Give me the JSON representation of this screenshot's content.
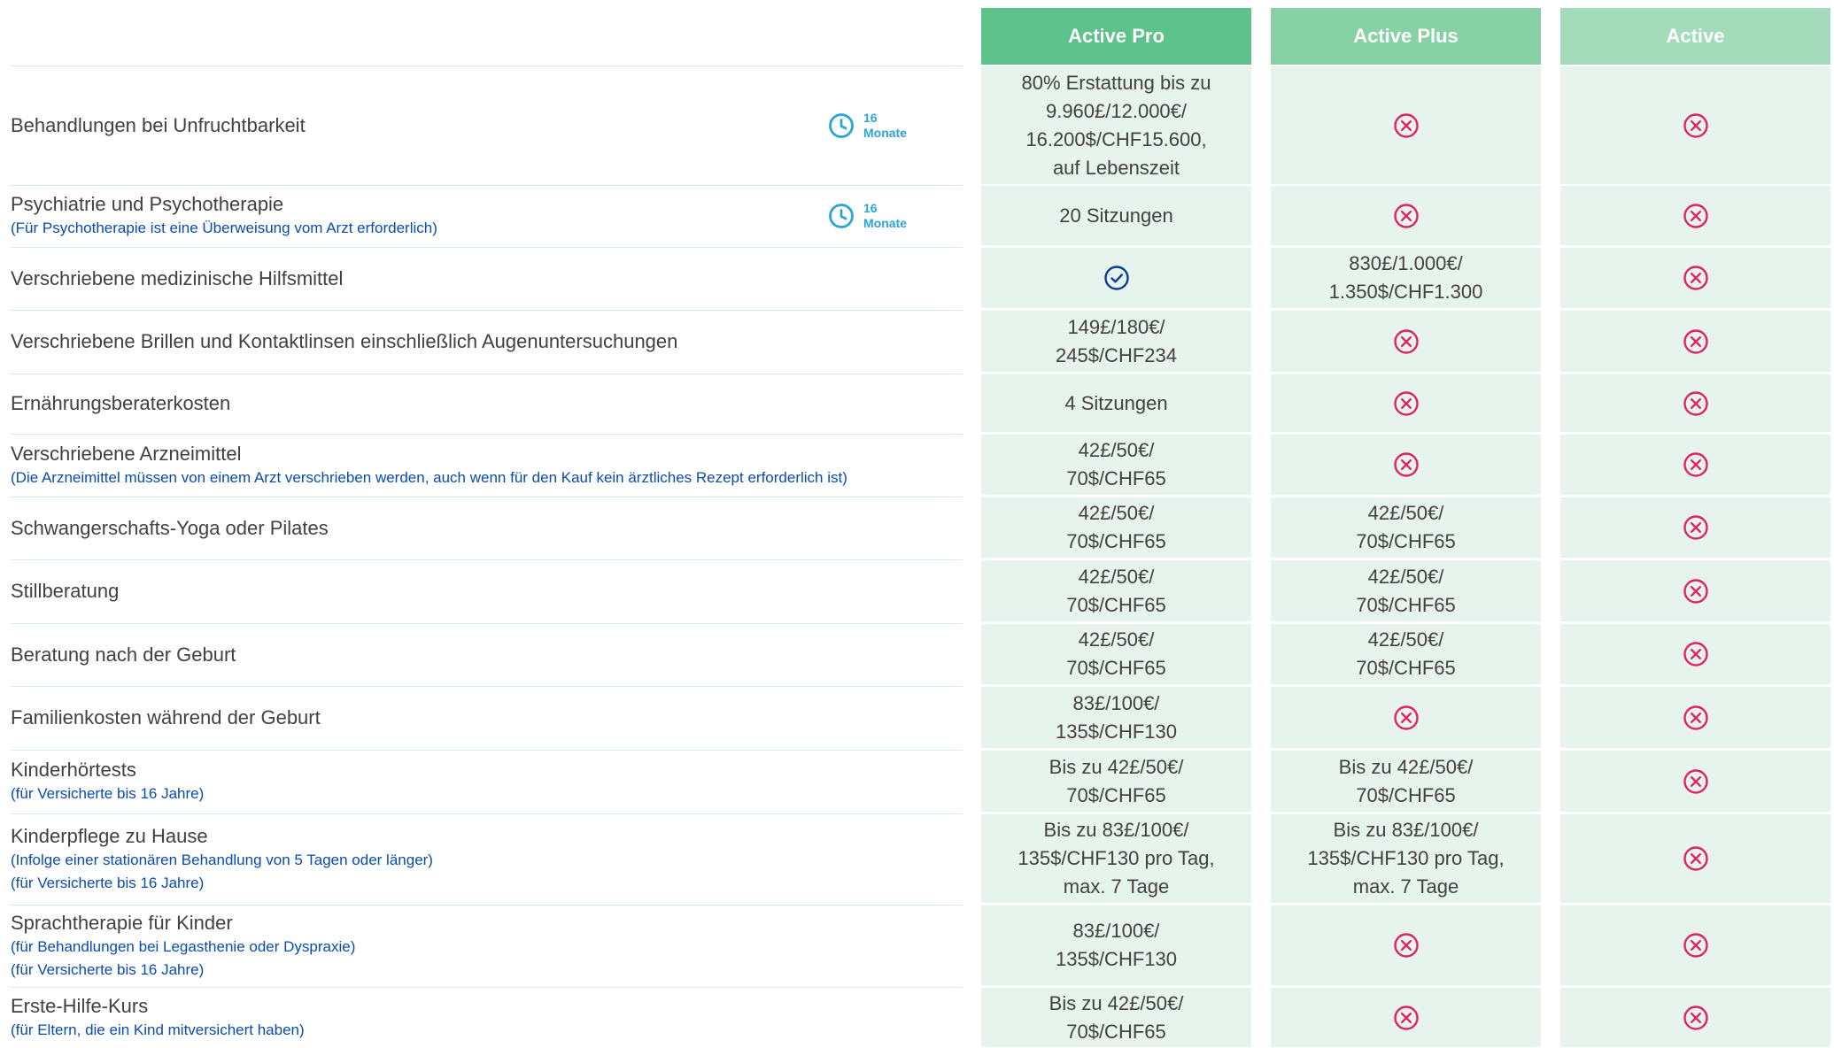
{
  "plans": [
    "Active Pro",
    "Active Plus",
    "Active"
  ],
  "colors": {
    "header_pro": "#5ec28d",
    "header_plus": "#88d1a6",
    "header_active": "#a4dcbb",
    "cell_bg": "#e6f4ed",
    "cross": "#e0235f",
    "check": "#0a3d91",
    "note": "#0a4bb0",
    "waiting": "#2aa5d6"
  },
  "icons": {
    "not_covered": "x-circle-icon",
    "covered": "check-circle-icon",
    "waiting_period": "clock-icon"
  },
  "rows": [
    {
      "label": "Behandlungen bei Unfruchtbarkeit",
      "notes": [],
      "waiting": {
        "number": "16",
        "unit": "Monate"
      },
      "values": [
        {
          "type": "text",
          "lines": [
            "80% Erstattung bis zu",
            "9.960£/12.000€/",
            "16.200$/CHF15.600,",
            "auf Lebenszeit"
          ]
        },
        {
          "type": "cross"
        },
        {
          "type": "cross"
        }
      ]
    },
    {
      "label": "Psychiatrie und Psychotherapie",
      "notes": [
        "(Für Psychotherapie ist eine Überweisung vom Arzt erforderlich)"
      ],
      "waiting": {
        "number": "16",
        "unit": "Monate"
      },
      "values": [
        {
          "type": "text",
          "lines": [
            "20 Sitzungen"
          ]
        },
        {
          "type": "cross"
        },
        {
          "type": "cross"
        }
      ]
    },
    {
      "label": "Verschriebene medizinische Hilfsmittel",
      "notes": [],
      "values": [
        {
          "type": "check"
        },
        {
          "type": "text",
          "lines": [
            "830£/1.000€/",
            "1.350$/CHF1.300"
          ]
        },
        {
          "type": "cross"
        }
      ]
    },
    {
      "label": "Verschriebene Brillen und Kontaktlinsen einschließlich Augenuntersuchungen",
      "notes": [],
      "values": [
        {
          "type": "text",
          "lines": [
            "149£/180€/",
            "245$/CHF234"
          ]
        },
        {
          "type": "cross"
        },
        {
          "type": "cross"
        }
      ]
    },
    {
      "label": "Ernährungsberaterkosten",
      "notes": [],
      "values": [
        {
          "type": "text",
          "lines": [
            "4 Sitzungen"
          ]
        },
        {
          "type": "cross"
        },
        {
          "type": "cross"
        }
      ]
    },
    {
      "label": "Verschriebene Arzneimittel",
      "notes": [
        "(Die Arzneimittel müssen von einem Arzt verschrieben werden, auch wenn für den Kauf kein ärztliches Rezept erforderlich ist)"
      ],
      "values": [
        {
          "type": "text",
          "lines": [
            "42£/50€/",
            "70$/CHF65"
          ]
        },
        {
          "type": "cross"
        },
        {
          "type": "cross"
        }
      ]
    },
    {
      "label": "Schwangerschafts-Yoga oder Pilates",
      "notes": [],
      "values": [
        {
          "type": "text",
          "lines": [
            "42£/50€/",
            "70$/CHF65"
          ]
        },
        {
          "type": "text",
          "lines": [
            "42£/50€/",
            "70$/CHF65"
          ]
        },
        {
          "type": "cross"
        }
      ]
    },
    {
      "label": "Stillberatung",
      "notes": [],
      "values": [
        {
          "type": "text",
          "lines": [
            "42£/50€/",
            "70$/CHF65"
          ]
        },
        {
          "type": "text",
          "lines": [
            "42£/50€/",
            "70$/CHF65"
          ]
        },
        {
          "type": "cross"
        }
      ]
    },
    {
      "label": "Beratung nach der Geburt",
      "notes": [],
      "values": [
        {
          "type": "text",
          "lines": [
            "42£/50€/",
            "70$/CHF65"
          ]
        },
        {
          "type": "text",
          "lines": [
            "42£/50€/",
            "70$/CHF65"
          ]
        },
        {
          "type": "cross"
        }
      ]
    },
    {
      "label": "Familienkosten während der Geburt",
      "notes": [],
      "values": [
        {
          "type": "text",
          "lines": [
            "83£/100€/",
            "135$/CHF130"
          ]
        },
        {
          "type": "cross"
        },
        {
          "type": "cross"
        }
      ]
    },
    {
      "label": "Kinderhörtests",
      "notes": [
        "(für Versicherte bis 16 Jahre)"
      ],
      "values": [
        {
          "type": "text",
          "lines": [
            "Bis zu 42£/50€/",
            "70$/CHF65"
          ]
        },
        {
          "type": "text",
          "lines": [
            "Bis zu 42£/50€/",
            "70$/CHF65"
          ]
        },
        {
          "type": "cross"
        }
      ]
    },
    {
      "label": "Kinderpflege zu Hause",
      "notes": [
        "(Infolge einer stationären Behandlung von 5 Tagen oder länger)",
        "(für Versicherte bis 16 Jahre)"
      ],
      "values": [
        {
          "type": "text",
          "lines": [
            "Bis zu 83£/100€/",
            "135$/CHF130 pro Tag,",
            "max. 7 Tage"
          ]
        },
        {
          "type": "text",
          "lines": [
            "Bis zu 83£/100€/",
            "135$/CHF130 pro Tag,",
            "max. 7 Tage"
          ]
        },
        {
          "type": "cross"
        }
      ]
    },
    {
      "label": "Sprachtherapie für Kinder",
      "notes": [
        "(für Behandlungen bei Legasthenie oder Dyspraxie)",
        "(für Versicherte bis 16 Jahre)"
      ],
      "values": [
        {
          "type": "text",
          "lines": [
            "83£/100€/",
            "135$/CHF130"
          ]
        },
        {
          "type": "cross"
        },
        {
          "type": "cross"
        }
      ]
    },
    {
      "label": "Erste-Hilfe-Kurs",
      "notes": [
        "(für Eltern, die ein Kind mitversichert haben)"
      ],
      "values": [
        {
          "type": "text",
          "lines": [
            "Bis zu 42£/50€/",
            "70$/CHF65"
          ]
        },
        {
          "type": "cross"
        },
        {
          "type": "cross"
        }
      ]
    }
  ]
}
